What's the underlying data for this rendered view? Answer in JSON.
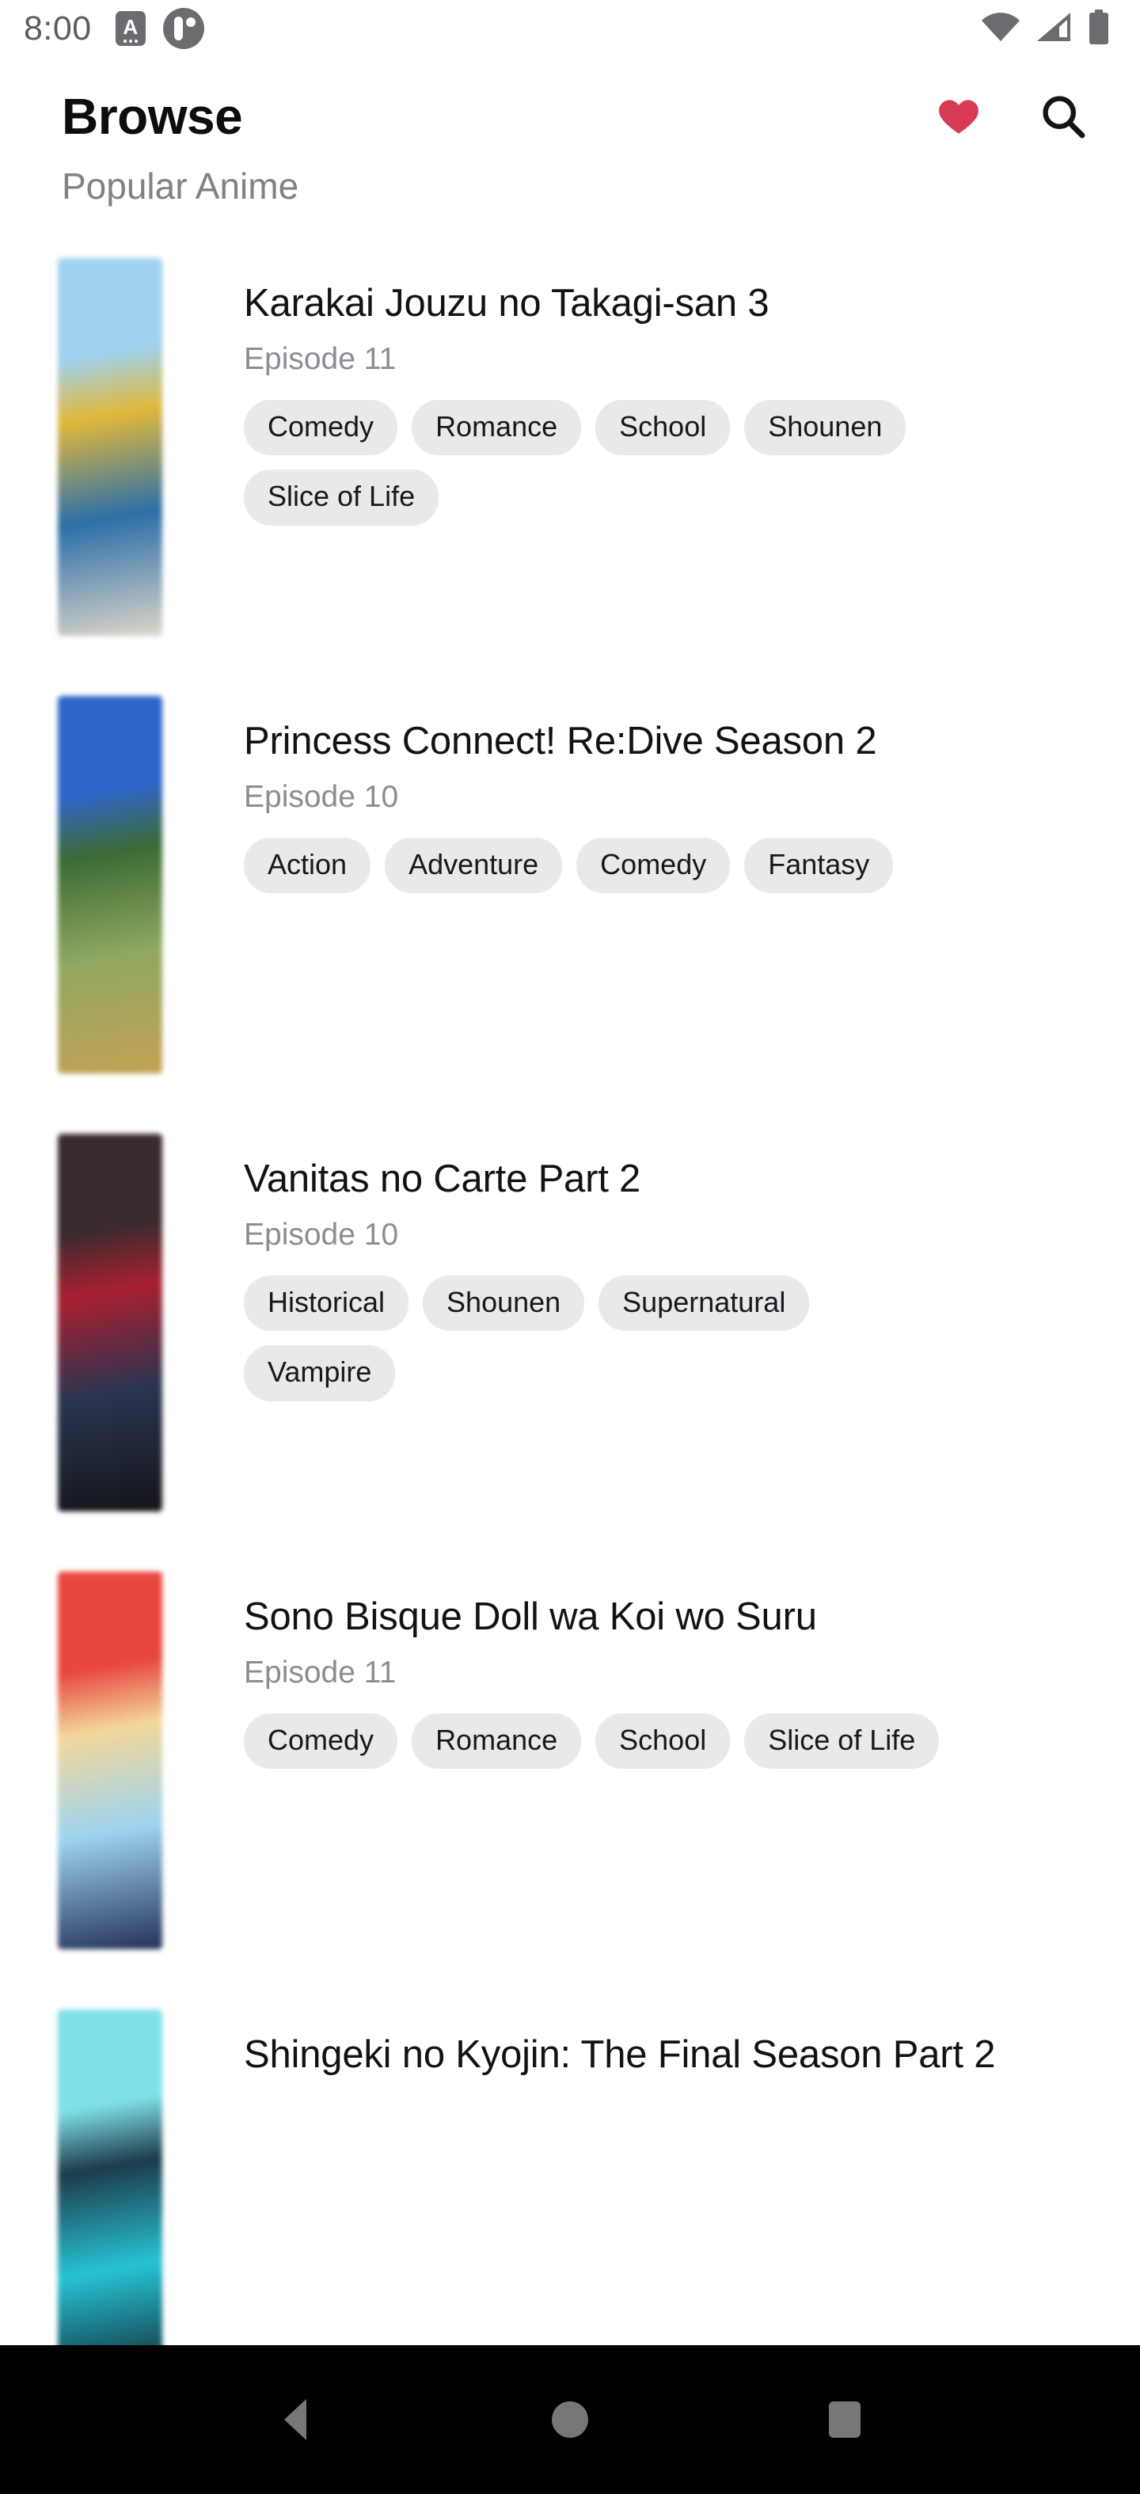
{
  "status_bar": {
    "time": "8:00",
    "notification_icons": [
      "subtitle-card-icon",
      "contrast-circle-icon"
    ],
    "right_icons": [
      "wifi-icon",
      "cellular-signal-icon",
      "battery-icon"
    ]
  },
  "app_bar": {
    "title": "Browse",
    "favorites_icon": "heart-icon",
    "search_icon": "search-icon",
    "favorites_color": "#d73a54"
  },
  "section": {
    "subtitle": "Popular Anime"
  },
  "nav_bar": {
    "back_label": "Back",
    "home_label": "Home",
    "recents_label": "Recents"
  },
  "anime": [
    {
      "title": "Karakai Jouzu no Takagi-san 3",
      "episode": "Episode 11",
      "genres": [
        "Comedy",
        "Romance",
        "School",
        "Shounen",
        "Slice of Life"
      ],
      "thumb_colors": [
        "#9fd2ee",
        "#e0b83c",
        "#2c6fa8",
        "#dcd6c9"
      ]
    },
    {
      "title": "Princess Connect! Re:Dive Season 2",
      "episode": "Episode 10",
      "genres": [
        "Action",
        "Adventure",
        "Comedy",
        "Fantasy"
      ],
      "thumb_colors": [
        "#2f66c9",
        "#3b6b34",
        "#8fa860",
        "#c4a257"
      ]
    },
    {
      "title": "Vanitas no Carte Part 2",
      "episode": "Episode 10",
      "genres": [
        "Historical",
        "Shounen",
        "Supernatural",
        "Vampire"
      ],
      "thumb_colors": [
        "#3a2b2e",
        "#a8202f",
        "#2a3550",
        "#141418"
      ]
    },
    {
      "title": "Sono Bisque Doll wa Koi wo Suru",
      "episode": "Episode 11",
      "genres": [
        "Comedy",
        "Romance",
        "School",
        "Slice of Life"
      ],
      "thumb_colors": [
        "#e8473f",
        "#f2d79a",
        "#9ed4ef",
        "#233159"
      ]
    },
    {
      "title": "Shingeki no Kyojin: The Final Season Part 2",
      "episode": "",
      "genres": [],
      "thumb_colors": [
        "#7fe0e8",
        "#1d3b4a",
        "#27c3d4",
        "#0e1a24"
      ]
    }
  ]
}
